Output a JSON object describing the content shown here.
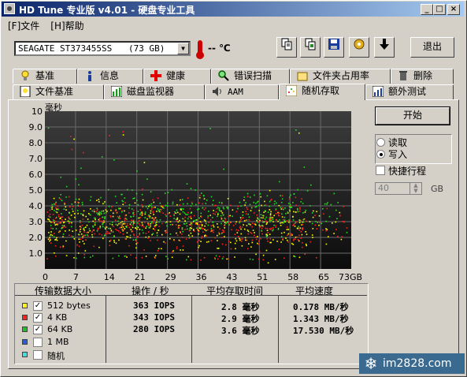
{
  "window": {
    "title": "HD Tune 专业版 v4.01 - 硬盘专业工具",
    "min": "_",
    "max": "□",
    "close": "×"
  },
  "menu": {
    "file": "[F]文件",
    "help": "[H]帮助"
  },
  "toolbar": {
    "drive": "SEAGATE ST373455SS",
    "capacity": "(73 GB)",
    "temp": "-- ℃",
    "exit": "退出"
  },
  "tabs_top": [
    "基准",
    "信息",
    "健康",
    "错误扫描",
    "文件夹占用率",
    "删除"
  ],
  "tabs_bottom": [
    "文件基准",
    "磁盘监视器",
    "AAM",
    "随机存取",
    "额外测试"
  ],
  "chart_data": {
    "type": "scatter",
    "ylabel": "毫秒",
    "yticks": [
      "10",
      "9.0",
      "8.0",
      "7.0",
      "6.0",
      "5.0",
      "4.0",
      "3.0",
      "2.0",
      "1.0"
    ],
    "xticks": [
      "0",
      "7",
      "14",
      "21",
      "29",
      "36",
      "43",
      "51",
      "58",
      "65",
      "73GB"
    ],
    "xlim": [
      0,
      73
    ],
    "ylim": [
      0,
      10
    ],
    "series": [
      {
        "name": "512 bytes",
        "color": "#ffff00",
        "mean_ms": 2.8
      },
      {
        "name": "4 KB",
        "color": "#ff2020",
        "mean_ms": 2.9
      },
      {
        "name": "64 KB",
        "color": "#20e020",
        "mean_ms": 3.6
      }
    ]
  },
  "controls": {
    "start": "开始",
    "read": "读取",
    "write": "写入",
    "quick": "快捷行程",
    "size": "40",
    "unit": "GB"
  },
  "table": {
    "headers": [
      "传输数据大小",
      "操作 / 秒",
      "平均存取时间",
      "平均速度"
    ],
    "rows": [
      {
        "label": "512 bytes",
        "color": "#ffff00",
        "checked": true,
        "ops": "363 IOPS",
        "access": "2.8 毫秒",
        "speed": "0.178 MB/秒"
      },
      {
        "label": "4 KB",
        "color": "#ff2020",
        "checked": true,
        "ops": "343 IOPS",
        "access": "2.9 毫秒",
        "speed": "1.343 MB/秒"
      },
      {
        "label": "64 KB",
        "color": "#20c020",
        "checked": true,
        "ops": "280 IOPS",
        "access": "3.6 毫秒",
        "speed": "17.530 MB/秒"
      },
      {
        "label": "1 MB",
        "color": "#2060e0",
        "checked": false,
        "ops": "",
        "access": "",
        "speed": ""
      },
      {
        "label": "随机",
        "color": "#40e0e0",
        "checked": false,
        "ops": "",
        "access": "",
        "speed": ""
      }
    ]
  },
  "watermark": "im2828.com"
}
